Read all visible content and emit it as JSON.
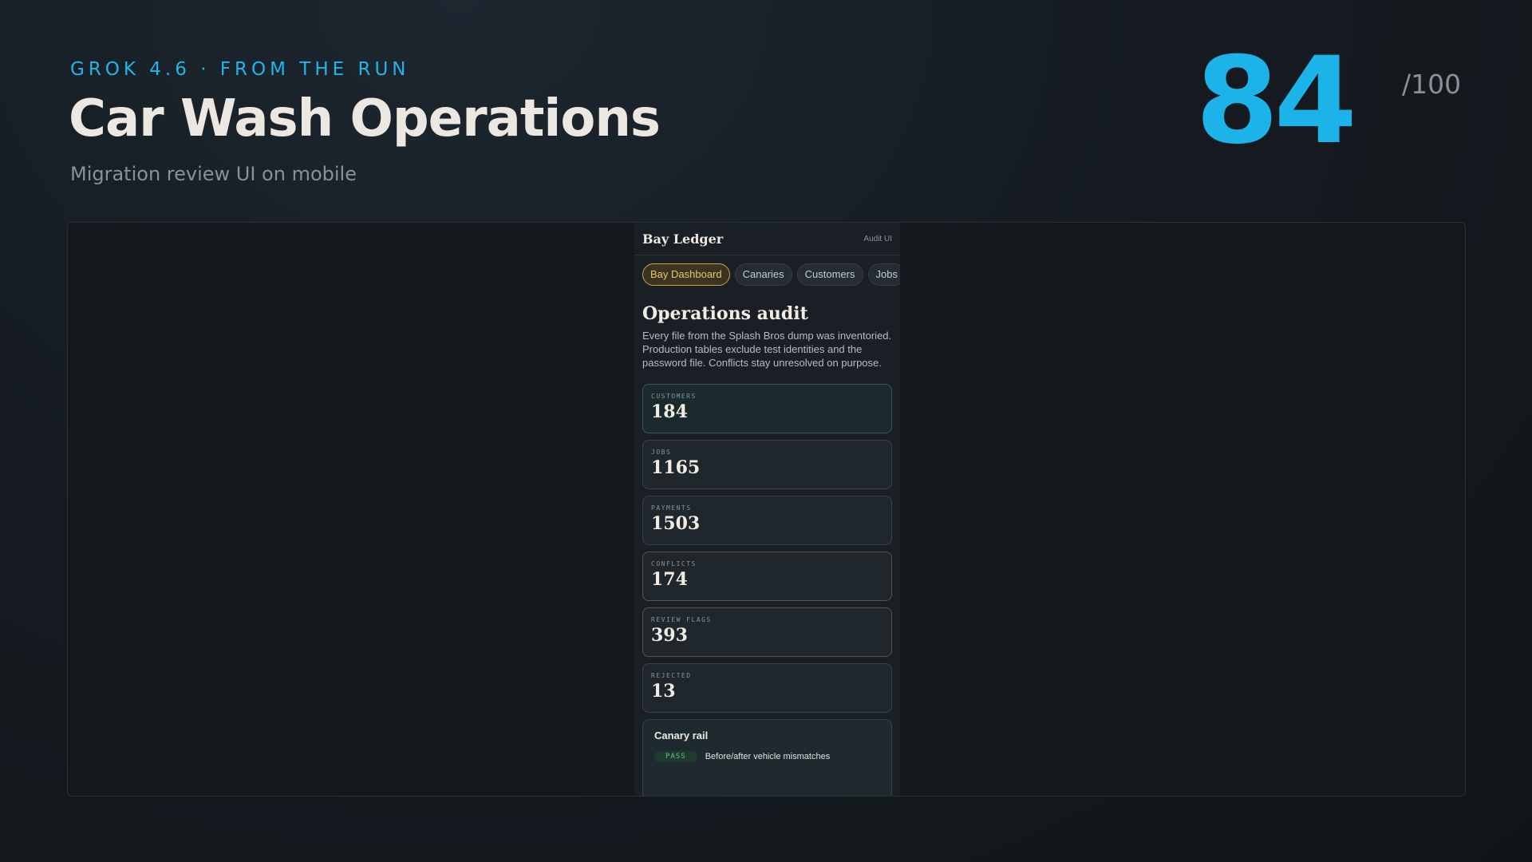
{
  "header": {
    "eyebrow": "GROK 4.6 · FROM THE RUN",
    "title": "Car Wash Operations",
    "subtitle": "Migration review UI on mobile",
    "score": "84",
    "score_max": "/100"
  },
  "app": {
    "brand": "Bay Ledger",
    "tag": "Audit UI",
    "tabs": [
      "Bay Dashboard",
      "Canaries",
      "Customers",
      "Jobs"
    ],
    "active_tab": "Bay Dashboard",
    "heading": "Operations audit",
    "intro": "Every file from the Splash Bros dump was inventoried. Production tables exclude test identities and the password file. Conflicts stay unresolved on purpose.",
    "stats": [
      {
        "label": "CUSTOMERS",
        "value": "184"
      },
      {
        "label": "JOBS",
        "value": "1165"
      },
      {
        "label": "PAYMENTS",
        "value": "1503"
      },
      {
        "label": "CONFLICTS",
        "value": "174"
      },
      {
        "label": "REVIEW FLAGS",
        "value": "393"
      },
      {
        "label": "REJECTED",
        "value": "13"
      }
    ],
    "canary": {
      "title": "Canary rail",
      "rows": [
        {
          "status": "PASS",
          "text": "Before/after vehicle mismatches"
        }
      ]
    }
  },
  "colors": {
    "accent": "#1cb4e8",
    "active_tab": "#c9a54a",
    "pass": "#5fc08b"
  }
}
